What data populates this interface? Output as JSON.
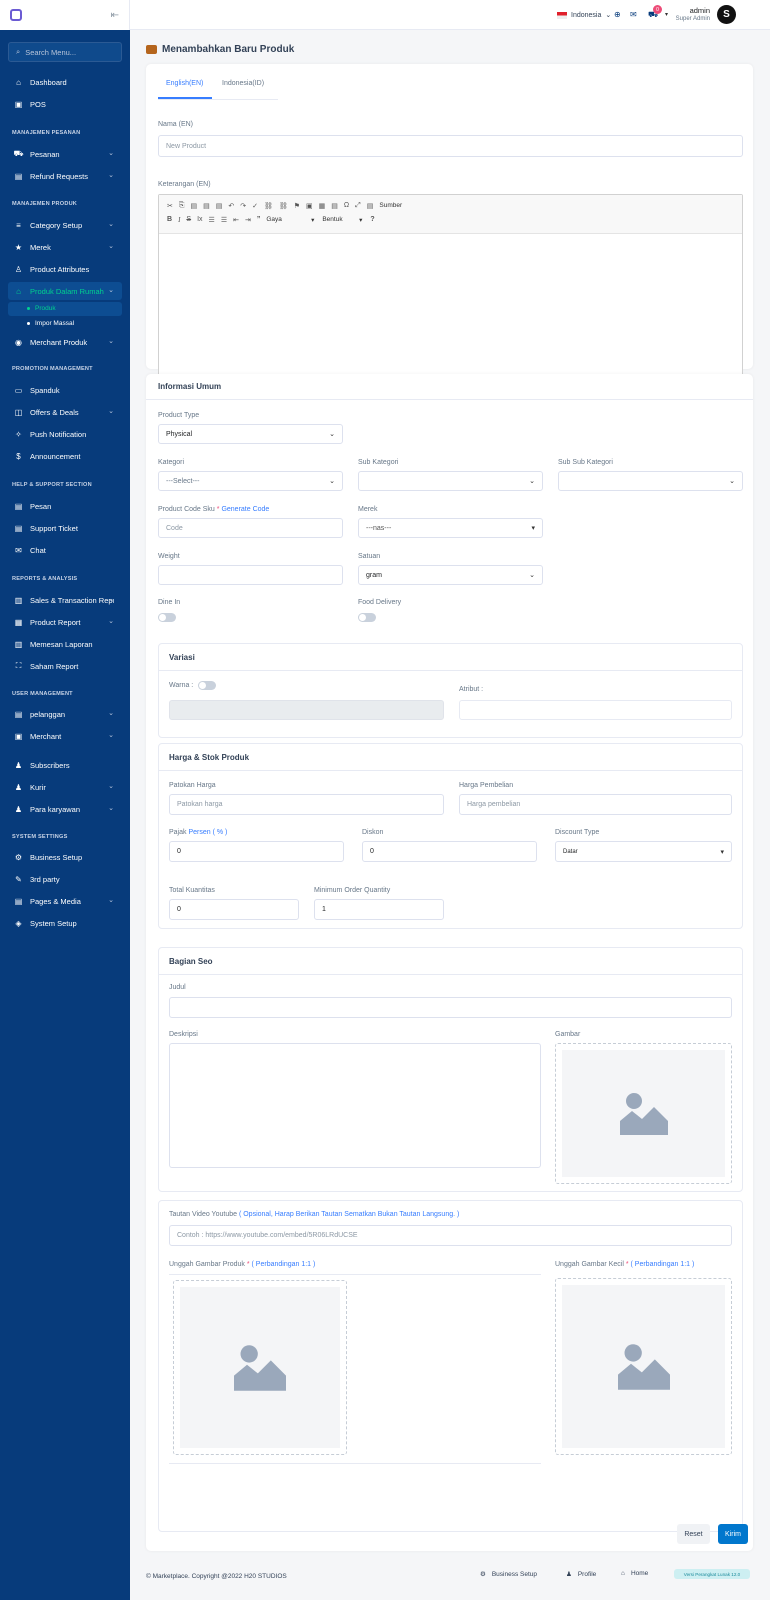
{
  "sidebar": {
    "search_placeholder": "Search Menu...",
    "sections": {
      "pesanan": "MANAJEMEN PESANAN",
      "produk": "MANAJEMEN PRODUK",
      "promo": "PROMOTION MANAGEMENT",
      "help": "HELP & SUPPORT SECTION",
      "reports": "REPORTS & ANALYSIS",
      "users": "USER MANAGEMENT",
      "system": "SYSTEM SETTINGS"
    },
    "items": {
      "dashboard": "Dashboard",
      "pos": "POS",
      "pesanan": "Pesanan",
      "refund": "Refund Requests",
      "category": "Category Setup",
      "merek": "Merek",
      "attributes": "Product Attributes",
      "inhouse": "Produk Dalam Rumah",
      "produk": "Produk",
      "impor": "Impor Massal",
      "merchant_produk": "Merchant Produk",
      "spanduk": "Spanduk",
      "offers": "Offers & Deals",
      "push": "Push Notification",
      "announcement": "Announcement",
      "pesan": "Pesan",
      "ticket": "Support Ticket",
      "chat": "Chat",
      "sales": "Sales & Transaction Report",
      "product_report": "Product Report",
      "memesan": "Memesan Laporan",
      "saham": "Saham Report",
      "pelanggan": "pelanggan",
      "merchant": "Merchant",
      "subscribers": "Subscribers",
      "kurir": "Kurir",
      "karyawan": "Para karyawan",
      "business": "Business Setup",
      "third": "3rd party",
      "pages": "Pages & Media",
      "system": "System Setup"
    }
  },
  "topbar": {
    "language": "Indonesia",
    "cart_count": "0",
    "user_name": "admin",
    "user_role": "Super Admin"
  },
  "page": {
    "title": "Menambahkan Baru Produk"
  },
  "lang_tabs": {
    "en": "English(EN)",
    "id": "Indonesia(ID)"
  },
  "desc_form": {
    "name_label": "Nama (EN)",
    "name_placeholder": "New Product",
    "desc_label": "Keterangan (EN)",
    "source_btn": "Sumber",
    "style_select": "Gaya",
    "format_select": "Bentuk"
  },
  "general": {
    "title": "Informasi Umum",
    "product_type_label": "Product Type",
    "product_type_value": "Physical",
    "kategori_label": "Kategori",
    "kategori_value": "---Select---",
    "sub_kategori_label": "Sub Kategori",
    "sub_sub_label": "Sub Sub Kategori",
    "sku_label": "Product Code Sku",
    "required_mark": "*",
    "generate_code": "Generate Code",
    "code_placeholder": "Code",
    "merek_label": "Merek",
    "merek_value": "---nas---",
    "weight_label": "Weight",
    "satuan_label": "Satuan",
    "satuan_value": "gram",
    "dine_in": "Dine In",
    "food_delivery": "Food Delivery"
  },
  "variasi": {
    "title": "Variasi",
    "warna": "Warna :",
    "atribut": "Atribut :"
  },
  "harga": {
    "title": "Harga & Stok Produk",
    "patokan_label": "Patokan Harga",
    "patokan_placeholder": "Patokan harga",
    "pembelian_label": "Harga Pembelian",
    "pembelian_placeholder": "Harga pembelian",
    "pajak_label": "Pajak",
    "pajak_hint": "Persen ( % )",
    "pajak_value": "0",
    "diskon_label": "Diskon",
    "diskon_value": "0",
    "discount_type_label": "Discount Type",
    "discount_type_value": "Datar",
    "total_label": "Total Kuantitas",
    "total_value": "0",
    "min_order_label": "Minimum Order Quantity",
    "min_order_value": "1"
  },
  "seo": {
    "title": "Bagian Seo",
    "judul": "Judul",
    "deskripsi": "Deskripsi",
    "gambar": "Gambar"
  },
  "media": {
    "youtube_label": "Tautan Video Youtube",
    "youtube_hint": "( Opsional, Harap Berikan Tautan Sematkan Bukan Tautan Langsung. )",
    "youtube_placeholder": "Contoh : https://www.youtube.com/embed/5R06LRdUCSE",
    "upload_label": "Unggah Gambar Produk",
    "upload_hint": "( Perbandingan 1:1 )",
    "thumb_label": "Unggah Gambar Kecil",
    "thumb_hint": "( Perbandingan 1:1 )"
  },
  "actions": {
    "reset": "Reset",
    "submit": "Kirim"
  },
  "footer": {
    "copyright": "© Marketplace. Copyright @2022 H20 STUDIOS",
    "business": "Business Setup",
    "profile": "Profile",
    "home": "Home",
    "version": "Versi Perangkat Lunak 12.0"
  }
}
